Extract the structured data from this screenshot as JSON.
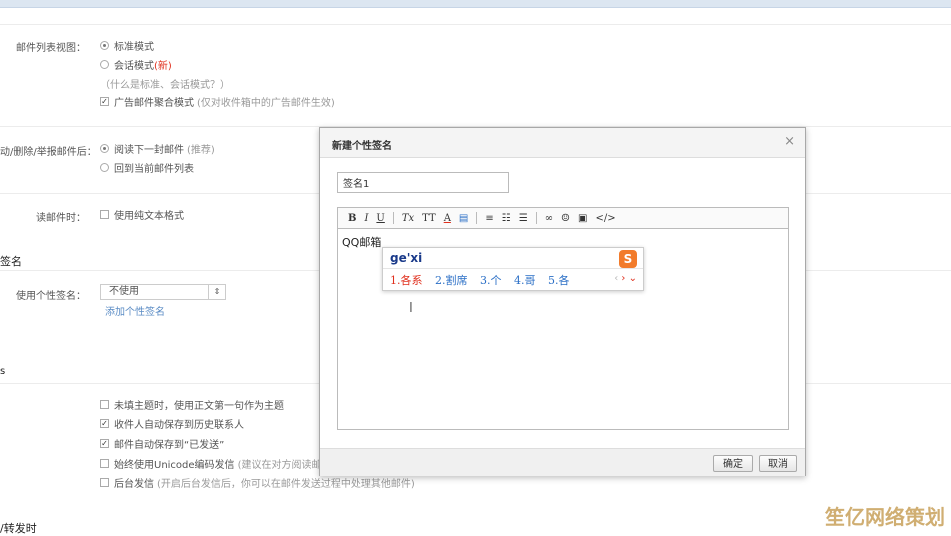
{
  "settings": {
    "mail_list_view": {
      "label": "邮件列表视图：",
      "options": [
        "标准模式",
        "会话模式"
      ],
      "new_tag": "(新)",
      "help": "（什么是标准、会话模式？）",
      "ad_option": "广告邮件聚合模式",
      "ad_hint": "(仅对收件箱中的广告邮件生效)"
    },
    "after_move": {
      "label": "动/删除/举报邮件后：",
      "option1": "阅读下一封邮件",
      "option1_hint": "(推荐)",
      "option2": "回到当前邮件列表"
    },
    "read_mail": {
      "label": "读邮件时：",
      "option": "使用纯文本格式"
    },
    "signature": {
      "section": "签名",
      "label": "使用个性签名：",
      "select_value": "不使用",
      "add_link": "添加个性签名"
    },
    "send": {
      "options": [
        "未填主题时，使用正文第一句作为主题",
        "收件人自动保存到历史联系人",
        "邮件自动保存到“已发送”",
        "始终使用Unicode编码发信",
        "后台发信"
      ],
      "unicode_hint": "(建议在对方阅读邮件",
      "bg_hint": "(开启后台发信后，你可以在邮件发送过程中处理其他邮件)"
    },
    "forward_section": "/转发时",
    "left_marker": "s"
  },
  "dialog": {
    "title": "新建个性签名",
    "close": "×",
    "name_value": "签名1",
    "toolbar": [
      "B",
      "I",
      "U",
      "Tx",
      "TT",
      "A",
      "▤",
      "≡",
      "☷",
      "☰",
      "∞",
      "☺",
      "▣",
      "</>"
    ],
    "editor_text": "QQ邮箱",
    "cursor": "I",
    "confirm": "确定",
    "cancel": "取消"
  },
  "ime": {
    "composition": "ge'xi",
    "candidates": [
      "1.各系",
      "2.割席",
      "3.个",
      "4.哥",
      "5.各"
    ],
    "logo": "S",
    "nav": [
      "‹",
      "›",
      "⌄"
    ]
  },
  "watermark": "笙亿网络策划"
}
